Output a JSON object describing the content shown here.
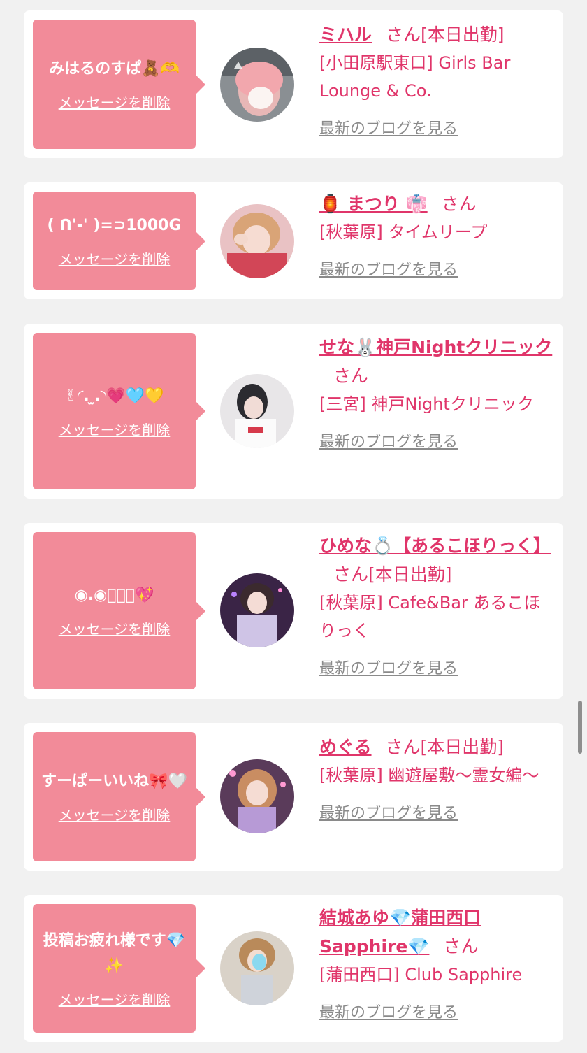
{
  "common": {
    "delete_label": "メッセージを削除",
    "honorific": "さん",
    "blog_label": "最新のブログを見る"
  },
  "colors": {
    "page_bg": "#f1f1f1",
    "bubble_bg": "#f28b99",
    "accent": "#e0356a",
    "muted_link": "#8a8a8a"
  },
  "messages": [
    {
      "message": "みはるのすぱ🧸🫶",
      "name": "ミハル",
      "status": "[本日出勤]",
      "shop": "[小田原駅東口] Girls Bar Lounge & Co."
    },
    {
      "message": "( ᑎ'-' )=⊃1000G",
      "name": "🏮 まつり 👘",
      "status": "",
      "shop": "[秋葉原] タイムリープ"
    },
    {
      "message": "✌︎◜. ̫.◝💗🩵💛",
      "name": "せな🐰神戸Nightクリニック",
      "status": "",
      "shop": "[三宮] 神戸Nightクリニック"
    },
    {
      "message": "◉.◉ﾞﾞﾞ💖",
      "name": "ひめな💍【あるこほりっく】",
      "status": "[本日出勤]",
      "shop": "[秋葉原] Cafe&Bar あるこほりっく"
    },
    {
      "message": "すーぱーいいね🎀🤍",
      "name": "めぐる",
      "status": "[本日出勤]",
      "shop": "[秋葉原] 幽遊屋敷〜霊女編〜"
    },
    {
      "message": "投稿お疲れ様です💎✨",
      "name": "結城あゆ💎蒲田西口Sapphire💎",
      "status": "",
      "shop": "[蒲田西口] Club Sapphire"
    }
  ]
}
